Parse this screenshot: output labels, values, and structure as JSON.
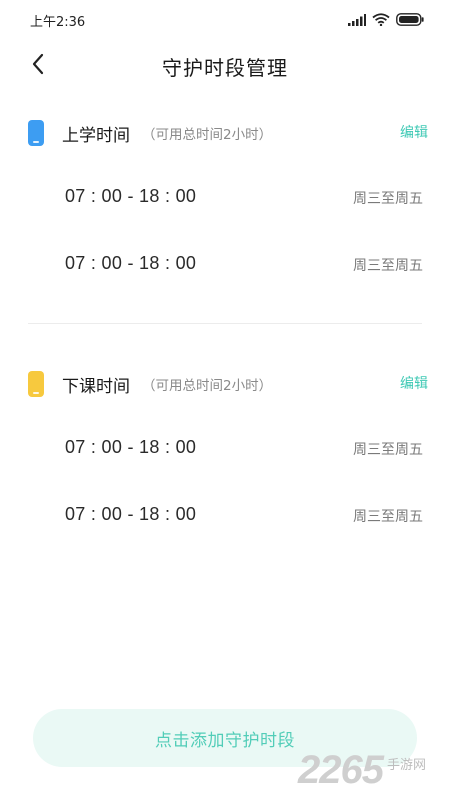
{
  "status_bar": {
    "time": "上午2:36",
    "icons": [
      "signal-icon",
      "wifi-icon",
      "battery-icon"
    ]
  },
  "header": {
    "title": "守护时段管理",
    "back_icon": "chevron-left-icon"
  },
  "sections": [
    {
      "icon": "phone-icon",
      "icon_color": "#3d9df2",
      "title": "上学时间",
      "subtitle": "（可用总时间2小时）",
      "edit_label": "编辑",
      "rows": [
        {
          "range": "07 : 00 - 18 : 00",
          "days": "周三至周五"
        },
        {
          "range": "07 : 00 - 18 : 00",
          "days": "周三至周五"
        }
      ]
    },
    {
      "icon": "phone-icon",
      "icon_color": "#f7c93e",
      "title": "下课时间",
      "subtitle": "（可用总时间2小时）",
      "edit_label": "编辑",
      "rows": [
        {
          "range": "07 : 00 - 18 : 00",
          "days": "周三至周五"
        },
        {
          "range": "07 : 00 - 18 : 00",
          "days": "周三至周五"
        }
      ]
    }
  ],
  "add_button": {
    "label": "点击添加守护时段"
  },
  "watermark": {
    "logo": "2265",
    "text": "手游网"
  },
  "colors": {
    "accent": "#3ec9b4",
    "button_bg": "#eaf9f5",
    "button_text": "#52cdb8"
  }
}
